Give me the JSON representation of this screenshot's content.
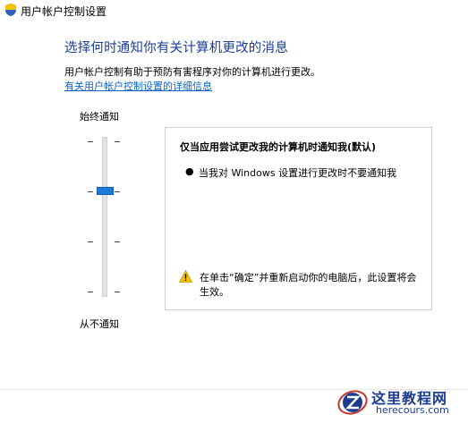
{
  "window": {
    "title": "用户帐户控制设置",
    "icon": "uac-shield-icon"
  },
  "main": {
    "heading": "选择何时通知你有关计算机更改的消息",
    "description": "用户帐户控制有助于预防有害程序对你的计算机进行更改。",
    "link": "有关用户帐户控制设置的详细信息"
  },
  "slider": {
    "top_label": "始终通知",
    "bottom_label": "从不通知",
    "level_count": 4,
    "selected_level": 3
  },
  "info": {
    "title": "仅当应用尝试更改我的计算机时通知我(默认)",
    "bullet": "当我对 Windows 设置进行更改时不要通知我",
    "warning_icon": "warning-icon",
    "warning": "在单击“确定”并重新启动你的电脑后，此设置将会生效。"
  },
  "watermark": {
    "name": "这里教程网",
    "url": "herecours.com"
  },
  "colors": {
    "heading": "#1a3e9a",
    "link": "#0a64c8",
    "thumb": "#1e7ad6",
    "warning": "#f2c200"
  }
}
